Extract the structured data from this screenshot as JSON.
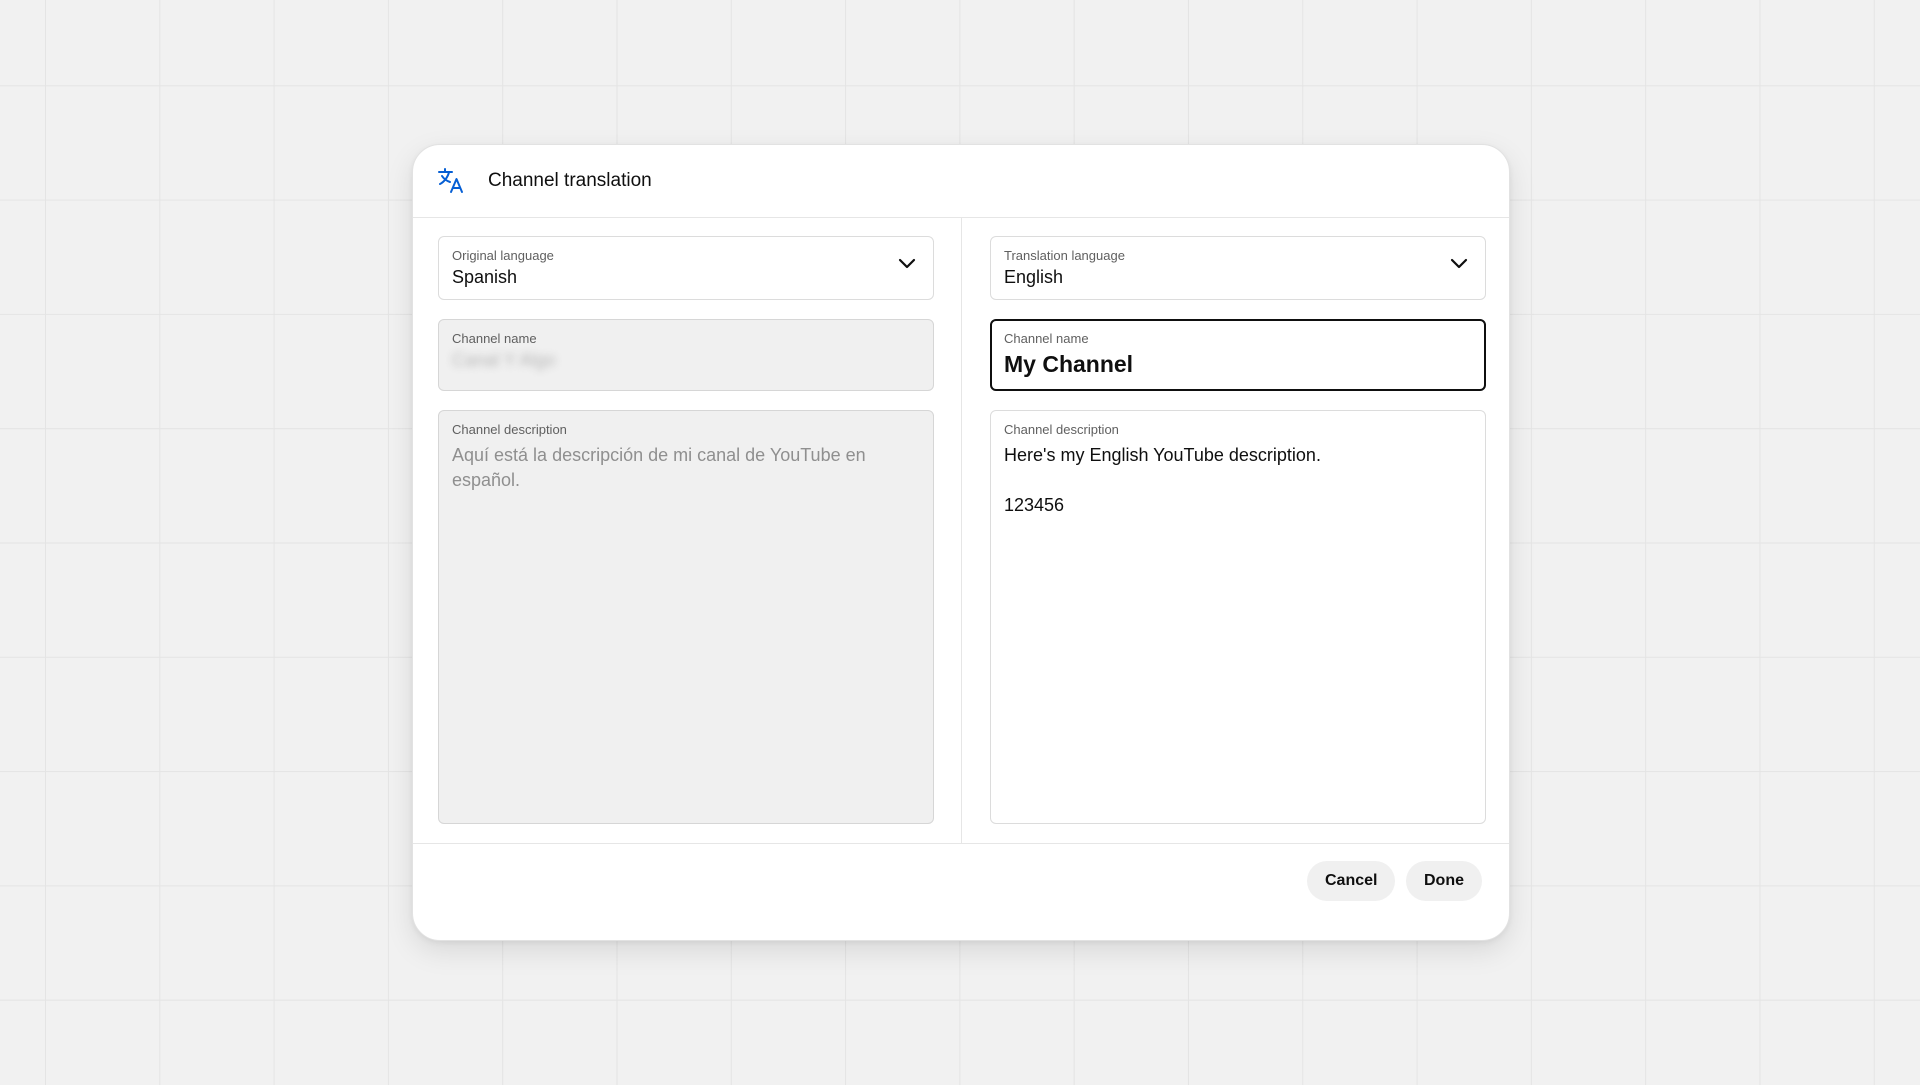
{
  "dialog": {
    "title": "Channel translation",
    "icon": "translate-icon",
    "accent_color": "#065fd4"
  },
  "original": {
    "language_label": "Original language",
    "language_value": "Spanish",
    "name_label": "Channel name",
    "name_value": "Canal Y Algo",
    "description_label": "Channel description",
    "description_value": "Aquí está la descripción de mi canal de YouTube en español."
  },
  "translation": {
    "language_label": "Translation language",
    "language_value": "English",
    "name_label": "Channel name",
    "name_value": "My Channel",
    "description_label": "Channel description",
    "description_value": "Here's my English YouTube description.\n\n123456"
  },
  "footer": {
    "cancel_label": "Cancel",
    "done_label": "Done"
  }
}
